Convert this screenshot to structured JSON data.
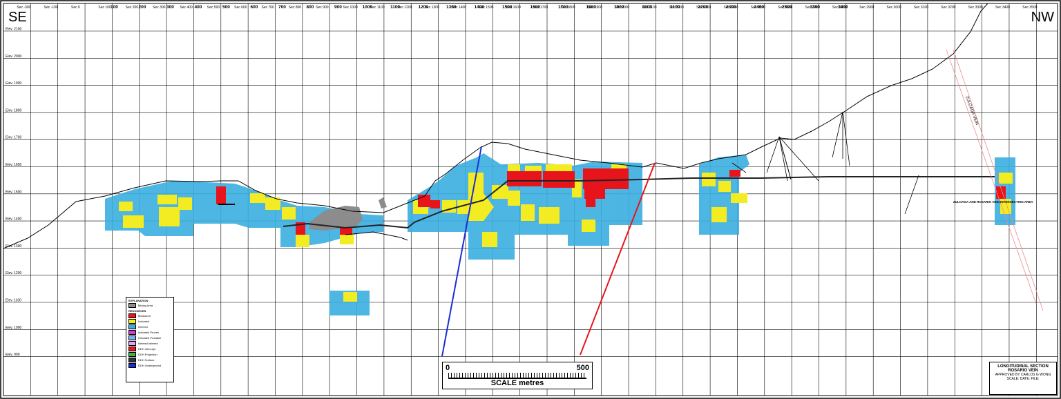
{
  "corners": {
    "left": "SE",
    "right": "NW"
  },
  "sections": [
    "Sec -300",
    "Sec -100",
    "Sec 0",
    "Sec 100",
    "Sec 200",
    "Sec 300",
    "Sec 400",
    "Sec 500",
    "Sec 600",
    "Sec 700",
    "Sec 800",
    "Sec 900",
    "Sec 1000",
    "Sec 1100",
    "Sec 1200",
    "Sec 1300",
    "Sec 1400",
    "Sec 1500",
    "Sec 1600",
    "Sec 1700",
    "Sec 1800",
    "Sec 1900",
    "Sec 2000",
    "Sec 2100",
    "Sec 2200",
    "Sec 2300",
    "Sec 2400",
    "Sec 2500",
    "Sec 2600",
    "Sec 2700",
    "Sec 2800",
    "Sec 2900",
    "Sec 3000",
    "Sec 3100",
    "Sec 3200",
    "Sec 3300",
    "Sec 3400",
    "Sec 3500"
  ],
  "section_labels": [
    "100",
    "200",
    "300",
    "400",
    "500",
    "600",
    "700",
    "800",
    "900",
    "1000",
    "1100",
    "1200",
    "1300",
    "1400",
    "1500",
    "1600",
    "1700",
    "1800",
    "1900",
    "2000",
    "2100",
    "2200",
    "2300",
    "2400",
    "2500",
    "3300",
    "3400"
  ],
  "elevations": [
    "Elev. 2100",
    "Elev. 2000",
    "Elev. 1900",
    "Elev. 1800",
    "Elev. 1700",
    "Elev. 1600",
    "Elev. 1500",
    "Elev. 1400",
    "Elev. 1300",
    "Elev. 1200",
    "Elev. 1100",
    "Elev. 1000",
    "Elev. 900"
  ],
  "zuloaga_label": "ZULOAGA VEIN",
  "intersection_label": "ZULOAGA AND ROSARIO VEIN INTERSECTION AREA",
  "legend": {
    "title": "EXPLANATION",
    "mined_label": "Mining Area",
    "resources_title": "RESOURCES",
    "items": [
      {
        "label": "Measured",
        "color": "#e8141b"
      },
      {
        "label": "Indicated",
        "color": "#f4ec22"
      },
      {
        "label": "Inferred",
        "color": "#3aaee0"
      },
      {
        "label": "Indicated Proven",
        "color": "#d63bc4"
      },
      {
        "label": "Indicated Probable",
        "color": "#7aaff0"
      },
      {
        "label": "Inferred Inferred",
        "color": "#e8a0f0"
      },
      {
        "label": "DDH Intercept",
        "color": "#e8141b"
      },
      {
        "label": "DDH Projection",
        "color": "#3db34a"
      },
      {
        "label": "DDH Surface",
        "color": "#333333"
      },
      {
        "label": "DDH Underground",
        "color": "#1b2fd6"
      }
    ]
  },
  "scale": {
    "start": "0",
    "end": "500",
    "title": "SCALE metres"
  },
  "title_block": {
    "title": "LONGITUDINAL SECTION ROSARIO VEIN",
    "approved": "APPROVED BY CARLOS G WONG",
    "fields": "SCALE:   DATE:   FILE:"
  },
  "colors": {
    "inferred": "#3aaee0",
    "indicated": "#f4ec22",
    "measured": "#e8141b",
    "mined": "#8c8c8c",
    "fault_blue": "#1b2fd6",
    "fault_red": "#e8141b",
    "zuloaga": "#f08a8a"
  }
}
